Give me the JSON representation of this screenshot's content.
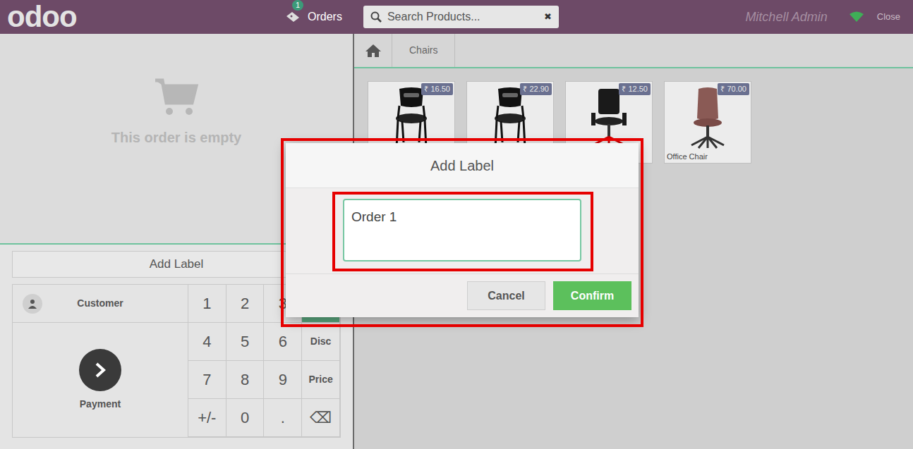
{
  "topbar": {
    "logo": "odoo",
    "orders": {
      "label": "Orders",
      "count": "1"
    },
    "search": {
      "placeholder": "Search Products...",
      "clear": "✖"
    },
    "user": "Mitchell Admin",
    "close": "Close",
    "online": true
  },
  "breadcrumb": [
    "Chairs"
  ],
  "products": [
    {
      "price": "₹ 16.50",
      "name": ""
    },
    {
      "price": "₹ 22.90",
      "name": ""
    },
    {
      "price": "₹ 12.50",
      "name": ""
    },
    {
      "price": "₹ 70.00",
      "name": "Office Chair"
    }
  ],
  "order": {
    "empty_text": "This order is empty",
    "add_label": "Add Label"
  },
  "actions": {
    "customer": "Customer",
    "payment": "Payment"
  },
  "keys": [
    {
      "label": "1",
      "kind": "digit",
      "selected": false
    },
    {
      "label": "2",
      "kind": "digit",
      "selected": false
    },
    {
      "label": "3",
      "kind": "digit",
      "selected": false
    },
    {
      "label": "",
      "kind": "mode",
      "selected": true
    },
    {
      "label": "4",
      "kind": "digit",
      "selected": false
    },
    {
      "label": "5",
      "kind": "digit",
      "selected": false
    },
    {
      "label": "6",
      "kind": "digit",
      "selected": false
    },
    {
      "label": "Disc",
      "kind": "mode",
      "selected": false
    },
    {
      "label": "7",
      "kind": "digit",
      "selected": false
    },
    {
      "label": "8",
      "kind": "digit",
      "selected": false
    },
    {
      "label": "9",
      "kind": "digit",
      "selected": false
    },
    {
      "label": "Price",
      "kind": "mode",
      "selected": false
    },
    {
      "label": "+/-",
      "kind": "digit",
      "selected": false
    },
    {
      "label": "0",
      "kind": "digit",
      "selected": false
    },
    {
      "label": ".",
      "kind": "digit",
      "selected": false
    },
    {
      "label": "⌫",
      "kind": "digit",
      "selected": false
    }
  ],
  "dialog": {
    "title": "Add Label",
    "value": "Order 1",
    "buttons": [
      {
        "label": "Cancel",
        "primary": false
      },
      {
        "label": "Confirm",
        "primary": true
      }
    ]
  }
}
